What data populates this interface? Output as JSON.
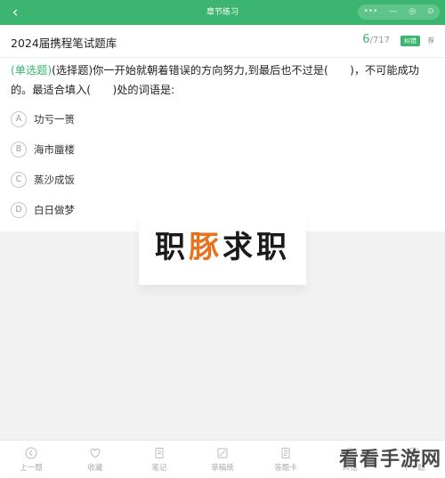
{
  "header": {
    "title": "章节练习",
    "capsule": [
      "•••",
      "—",
      "◎",
      "⊙"
    ]
  },
  "bank": {
    "title": "2024届携程笔试题库",
    "progress_current": "6",
    "progress_total": "/717",
    "feedback_label": "纠错",
    "more_label": "荐"
  },
  "question": {
    "type_label": "(单选题)",
    "text": "(选择题)你一开始就朝着错误的方向努力,到最后也不过是(　　)，不可能成功的。最适合填入(　　)处的词语是:"
  },
  "options": [
    {
      "letter": "A",
      "text": "功亏一篑"
    },
    {
      "letter": "B",
      "text": "海市蜃楼"
    },
    {
      "letter": "C",
      "text": "蒸沙成饭"
    },
    {
      "letter": "D",
      "text": "白日做梦"
    }
  ],
  "watermark": {
    "part1": "职",
    "part2": "豚",
    "part3": "求职"
  },
  "bottom_nav": [
    {
      "label": "上一题",
      "icon": "prev-icon"
    },
    {
      "label": "收藏",
      "icon": "heart-icon"
    },
    {
      "label": "笔记",
      "icon": "note-icon"
    },
    {
      "label": "草稿纸",
      "icon": "draft-icon"
    },
    {
      "label": "答题卡",
      "icon": "answer-card-icon"
    },
    {
      "label": "纠错",
      "icon": "error-icon"
    },
    {
      "label": "下一题",
      "icon": "next-icon"
    }
  ],
  "site_logo": "看看手游网",
  "colors": {
    "accent": "#3bb56f",
    "brand_orange": "#e8711d"
  }
}
